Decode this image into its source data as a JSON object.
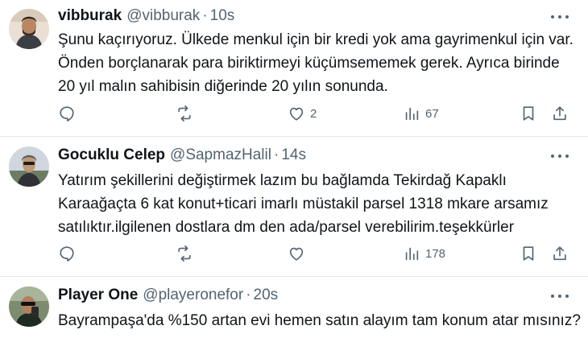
{
  "tweets": [
    {
      "name": "vibburak",
      "handle": "@vibburak",
      "separator": "·",
      "time": "10s",
      "lines": [
        "Şunu kaçırıyoruz. Ülkede menkul için bir kredi yok ama gayrimenkul için var.",
        "Önden borçlanarak para biriktirmeyi küçümsememek gerek. Ayrıca birinde",
        "20 yıl malın sahibisin diğerinde 20 yılın sonunda."
      ],
      "replies": "",
      "retweets": "",
      "likes": "2",
      "views": "67"
    },
    {
      "name": "Gocuklu Celep",
      "handle": "@SapmazHalil",
      "separator": "·",
      "time": "14s",
      "lines": [
        "Yatırım şekillerini değiştirmek lazım bu bağlamda  Tekirdağ Kapaklı",
        "Karaağaçta 6 kat konut+ticari imarlı müstakil parsel 1318 mkare arsamız",
        "satılıktır.ilgilenen dostlara dm den ada/parsel verebilirim.teşekkürler"
      ],
      "replies": "",
      "retweets": "",
      "likes": "",
      "views": "178"
    },
    {
      "name": "Player One",
      "handle": "@playeronefor",
      "separator": "·",
      "time": "20s",
      "lines": [
        "Bayrampaşa'da %150 artan evi hemen satın alayım tam konum atar mısınız?"
      ]
    }
  ],
  "icons": {
    "reply": "reply-icon",
    "retweet": "retweet-icon",
    "like": "heart-icon",
    "views": "analytics-icon",
    "bookmark": "bookmark-icon",
    "share": "share-icon",
    "more": "more-icon"
  },
  "colors": {
    "text": "#0f1419",
    "secondary": "#536471",
    "divider": "#e3e7ea"
  }
}
